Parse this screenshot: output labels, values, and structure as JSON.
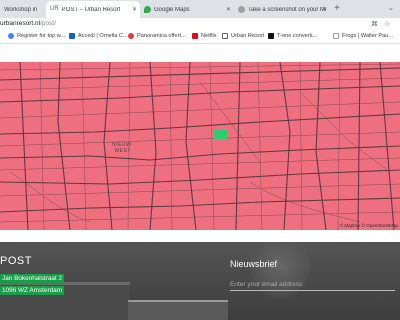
{
  "browser": {
    "tabs": [
      {
        "label": "Workshop in",
        "favicon_color": "#8e8e8e",
        "active": false
      },
      {
        "label": "POST – Urban Resort",
        "favicon_color": "#5f6368",
        "active": true
      },
      {
        "label": "Google Maps",
        "favicon_color": "#34a853",
        "active": false
      },
      {
        "label": "Take a screenshot on your Mac",
        "favicon_color": "#a0a0a0",
        "active": false
      }
    ],
    "new_tab": "+",
    "url_host": "urbanresort.nl",
    "url_path": "/post/",
    "bookmarks": [
      {
        "label": "Register for top w...",
        "color": "#4285f4"
      },
      {
        "label": "Accedi | Ornella C...",
        "color": "#1565c0"
      },
      {
        "label": "Panoramica offert...",
        "color": "#e53935"
      },
      {
        "label": "Netflix",
        "color": "#e50914"
      },
      {
        "label": "Urban Resort",
        "color": "#5f6368"
      },
      {
        "label": "T-one converti...",
        "color": "#111111"
      },
      {
        "label": "Frogs | Walter Pau...",
        "color": "#9e9e9e"
      }
    ]
  },
  "map": {
    "labels": [
      "NIEUW-",
      "WEST"
    ],
    "attribution": "© Mapbox © OpenStreetMap",
    "marker_color": "#2ecc71"
  },
  "footer": {
    "title": "POST",
    "address_line1": "Jan Bokenhalstraat 2",
    "address_line2": "1096 WZ Amsterdam",
    "newsletter_title": "Nieuwsbrief",
    "email_placeholder": "Enter your email address"
  }
}
